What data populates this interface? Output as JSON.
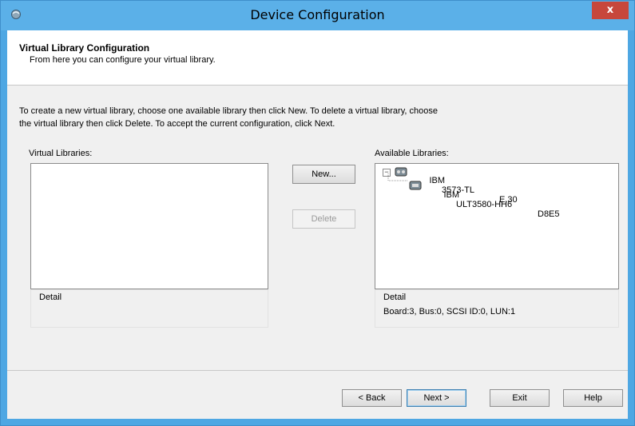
{
  "window": {
    "title": "Device Configuration",
    "close_label": "x"
  },
  "header": {
    "title": "Virtual Library Configuration",
    "subtitle": "From here you can configure your virtual library."
  },
  "instructions": {
    "line1": "To create a new virtual library, choose one available library then click New. To delete a virtual library, choose",
    "line2": "the virtual library then click Delete. To accept the current configuration, click Next."
  },
  "virtual_libraries": {
    "label": "Virtual Libraries:",
    "detail_label": "Detail",
    "detail_value": ""
  },
  "available_libraries": {
    "label": "Available Libraries:",
    "tree": [
      {
        "vendor": "IBM",
        "model": "3573-TL",
        "rev": "E.30",
        "expanded": true
      },
      {
        "vendor": "IBM",
        "model": "ULT3580-HH6",
        "rev": "D8E5"
      }
    ],
    "detail_label": "Detail",
    "detail_value": "Board:3, Bus:0, SCSI ID:0, LUN:1"
  },
  "buttons": {
    "new": "New...",
    "delete": "Delete",
    "back": "< Back",
    "next": "Next >",
    "exit": "Exit",
    "help": "Help"
  },
  "colors": {
    "titlebar": "#5bb0e8",
    "close": "#c7473b",
    "client": "#f0f0f0"
  }
}
